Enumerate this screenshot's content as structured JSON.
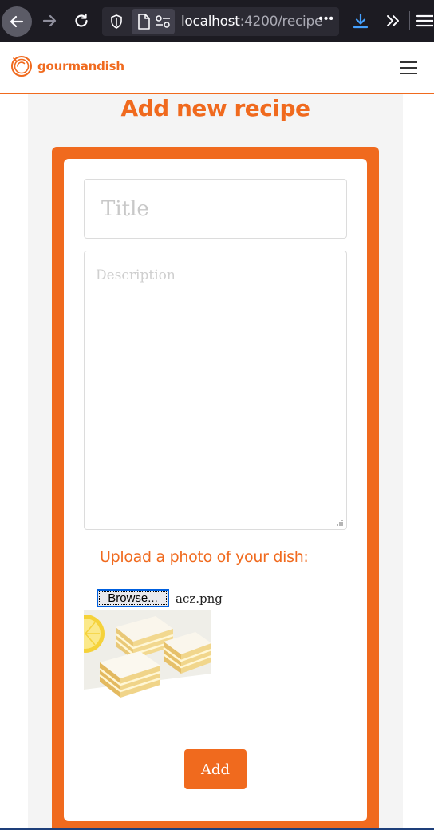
{
  "browser": {
    "url_host": "localhost",
    "url_path": ":4200/recipe",
    "more": "•••"
  },
  "header": {
    "brand": "gourmandish"
  },
  "page": {
    "title": "Add new recipe"
  },
  "form": {
    "title_placeholder": "Title",
    "title_value": "",
    "description_placeholder": "Description",
    "description_value": "",
    "upload_label": "Upload a photo of your dish:",
    "browse_label": "Browse...",
    "file_name": "acz.png",
    "submit_label": "Add"
  },
  "colors": {
    "accent": "#f06a1e",
    "browser_bg": "#1c1b22",
    "page_bg": "#f4f4f4"
  },
  "icons": [
    "back-arrow-icon",
    "forward-arrow-icon",
    "reload-icon",
    "shield-icon",
    "page-icon",
    "permissions-icon",
    "download-icon",
    "overflow-chevron-icon",
    "app-menu-icon",
    "logo-icon",
    "hamburger-icon"
  ]
}
